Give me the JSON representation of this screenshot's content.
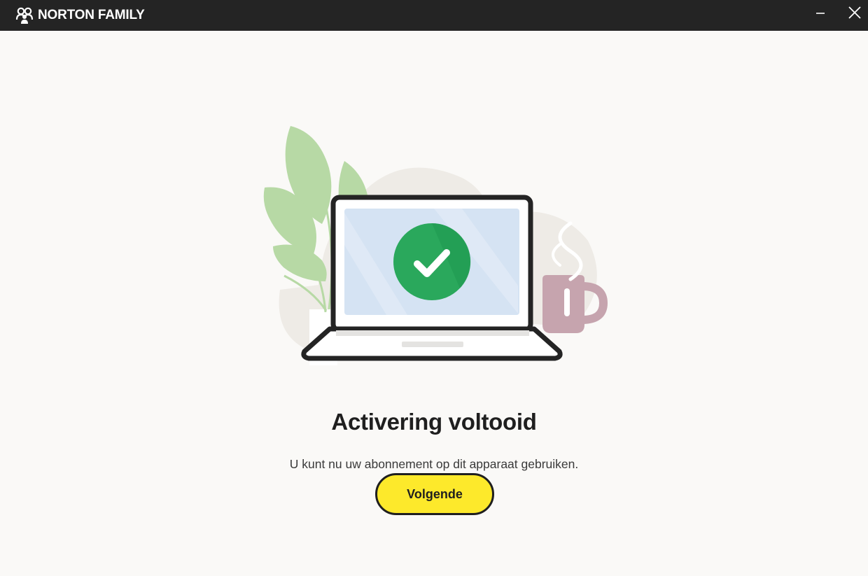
{
  "window": {
    "app_name": "NORTON FAMILY",
    "logo_icon": "norton-family-people-icon",
    "minimize_icon": "minimize-icon",
    "close_icon": "close-icon"
  },
  "illustration": {
    "icon": "laptop-checkmark-illustration",
    "check_icon": "checkmark-icon"
  },
  "content": {
    "title": "Activering voltooid",
    "subtitle": "U kunt nu uw abonnement op dit apparaat gebruiken.",
    "next_button": "Volgende"
  },
  "colors": {
    "titlebar": "#242424",
    "background": "#faf9f7",
    "button": "#fde92b",
    "check_green": "#2aa85c",
    "screen_blue": "#d5e3f3",
    "leaf_green": "#b7d9a5",
    "mug_pink": "#c6a4ae"
  }
}
